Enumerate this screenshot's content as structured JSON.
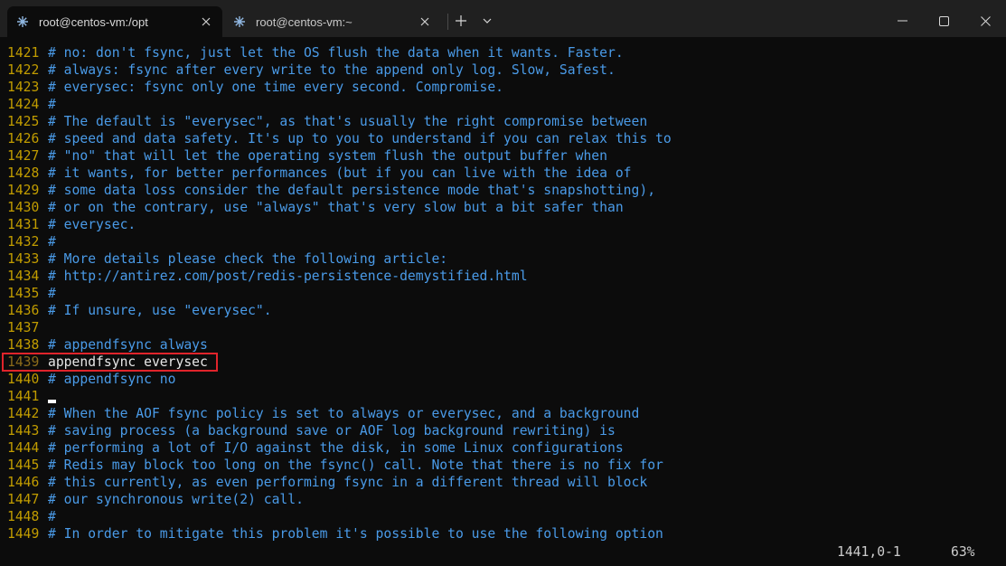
{
  "tabs": [
    {
      "label": "root@centos-vm:/opt",
      "active": true
    },
    {
      "label": "root@centos-vm:~",
      "active": false
    }
  ],
  "titlebar_icons": {
    "new_tab": "plus-icon",
    "dropdown": "chevron-down-icon",
    "minimize": "minimize-icon",
    "maximize": "maximize-icon",
    "close": "close-icon"
  },
  "lines": [
    {
      "num": "1421",
      "text": "# no: don't fsync, just let the OS flush the data when it wants. Faster.",
      "kind": "comment"
    },
    {
      "num": "1422",
      "text": "# always: fsync after every write to the append only log. Slow, Safest.",
      "kind": "comment"
    },
    {
      "num": "1423",
      "text": "# everysec: fsync only one time every second. Compromise.",
      "kind": "comment"
    },
    {
      "num": "1424",
      "text": "#",
      "kind": "comment"
    },
    {
      "num": "1425",
      "text": "# The default is \"everysec\", as that's usually the right compromise between",
      "kind": "comment"
    },
    {
      "num": "1426",
      "text": "# speed and data safety. It's up to you to understand if you can relax this to",
      "kind": "comment"
    },
    {
      "num": "1427",
      "text": "# \"no\" that will let the operating system flush the output buffer when",
      "kind": "comment"
    },
    {
      "num": "1428",
      "text": "# it wants, for better performances (but if you can live with the idea of",
      "kind": "comment"
    },
    {
      "num": "1429",
      "text": "# some data loss consider the default persistence mode that's snapshotting),",
      "kind": "comment"
    },
    {
      "num": "1430",
      "text": "# or on the contrary, use \"always\" that's very slow but a bit safer than",
      "kind": "comment"
    },
    {
      "num": "1431",
      "text": "# everysec.",
      "kind": "comment"
    },
    {
      "num": "1432",
      "text": "#",
      "kind": "comment"
    },
    {
      "num": "1433",
      "text": "# More details please check the following article:",
      "kind": "comment"
    },
    {
      "num": "1434",
      "text": "# http://antirez.com/post/redis-persistence-demystified.html",
      "kind": "comment"
    },
    {
      "num": "1435",
      "text": "#",
      "kind": "comment"
    },
    {
      "num": "1436",
      "text": "# If unsure, use \"everysec\".",
      "kind": "comment"
    },
    {
      "num": "1437",
      "text": "",
      "kind": "comment"
    },
    {
      "num": "1438",
      "text": "# appendfsync always",
      "kind": "comment"
    },
    {
      "num": "1439",
      "text": "appendfsync everysec",
      "kind": "code"
    },
    {
      "num": "1440",
      "text": "# appendfsync no",
      "kind": "comment"
    },
    {
      "num": "1441",
      "text": "",
      "kind": "comment"
    },
    {
      "num": "1442",
      "text": "# When the AOF fsync policy is set to always or everysec, and a background",
      "kind": "comment"
    },
    {
      "num": "1443",
      "text": "# saving process (a background save or AOF log background rewriting) is",
      "kind": "comment"
    },
    {
      "num": "1444",
      "text": "# performing a lot of I/O against the disk, in some Linux configurations",
      "kind": "comment"
    },
    {
      "num": "1445",
      "text": "# Redis may block too long on the fsync() call. Note that there is no fix for",
      "kind": "comment"
    },
    {
      "num": "1446",
      "text": "# this currently, as even performing fsync in a different thread will block",
      "kind": "comment"
    },
    {
      "num": "1447",
      "text": "# our synchronous write(2) call.",
      "kind": "comment"
    },
    {
      "num": "1448",
      "text": "#",
      "kind": "comment"
    },
    {
      "num": "1449",
      "text": "# In order to mitigate this problem it's possible to use the following option",
      "kind": "comment"
    }
  ],
  "status": {
    "position": "1441,0-1",
    "percent": "63%"
  },
  "highlighted_line": "1439",
  "colors": {
    "line_number": "#c19c00",
    "comment": "#4a9be8",
    "code": "#e6e6e6",
    "highlight_box": "#e0242b",
    "background": "#0c0c0c"
  }
}
